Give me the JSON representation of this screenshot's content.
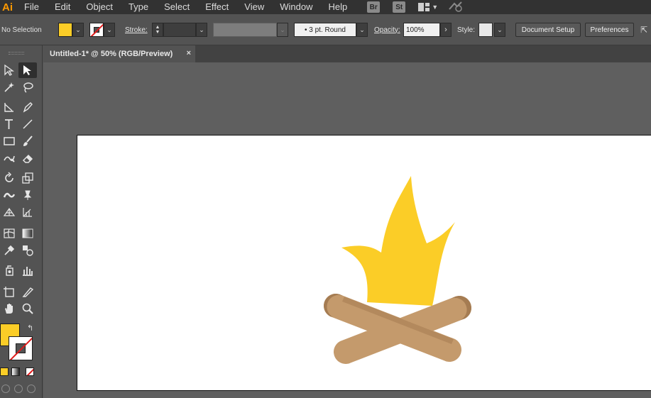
{
  "app": {
    "logo": "Ai"
  },
  "menu": [
    "File",
    "Edit",
    "Object",
    "Type",
    "Select",
    "Effect",
    "View",
    "Window",
    "Help"
  ],
  "menubar_buttons": {
    "bridge": "Br",
    "stock": "St"
  },
  "control": {
    "selection": "No Selection",
    "fill_color": "#fbcd27",
    "stroke_label": "Stroke:",
    "profile": "•  3 pt. Round",
    "opacity_label": "Opacity:",
    "opacity_value": "100%",
    "style_label": "Style:",
    "document_setup": "Document Setup",
    "preferences": "Preferences"
  },
  "document": {
    "tab_title": "Untitled-1* @ 50% (RGB/Preview)",
    "close": "×"
  },
  "toolbox": {
    "fill_color": "#fbcd27",
    "swap": "↰"
  },
  "artwork": {
    "flame_color": "#fbcd27",
    "log_color": "#c49a6c",
    "log_shadow": "#a57c52"
  }
}
